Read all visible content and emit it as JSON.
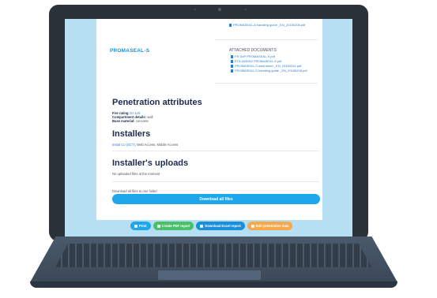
{
  "top_doc": {
    "text": "PROMASEAL-A handling guide _EN_20180208.pdf"
  },
  "product": {
    "name": "PROMASEAL-S",
    "attached_title": "ATTACHED DOCUMENTS",
    "documents": [
      "FR DoP PROMASEAL-S.pdf",
      "ETA 16/0262 PROMASEAL-S.pdf",
      "PROMASEAL-S data sheet _EN_20180314.pdf",
      "PROMASEAL-S handling guide _EN_20180208.pdf"
    ]
  },
  "penetration": {
    "title": "Penetration attributes",
    "fire_rating_label": "Fire rating:",
    "fire_rating_value": "EI 120",
    "compartment_label": "Compartment details:",
    "compartment_value": "wall",
    "base_material_label": "Base material:",
    "base_material_value": "concrete"
  },
  "installers": {
    "title": "Installers",
    "entry": "Instal Co (SCT)",
    "entry_rest": ", Web Access, Mobile Access"
  },
  "uploads": {
    "title": "Installer's uploads",
    "empty_text": "No uploaded files at the moment",
    "download_hint": "Download all files to one folder",
    "download_button": "Download all files"
  },
  "actions": {
    "print": "Print",
    "pdf": "Create PDF report",
    "excel": "Download Excel report",
    "edit": "Edit penetration data"
  },
  "colors": {
    "print": "#1ea7ea",
    "pdf": "#49c06a",
    "excel": "#1b8fd9",
    "edit": "#f6a84a"
  }
}
